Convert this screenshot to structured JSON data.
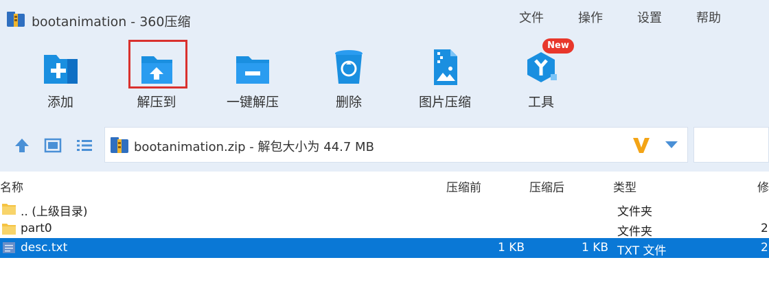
{
  "window": {
    "title": "bootanimation - 360压缩",
    "menu": [
      "文件",
      "操作",
      "设置",
      "帮助"
    ]
  },
  "toolbar": {
    "items": [
      {
        "label": "添加",
        "icon": "add-folder-icon"
      },
      {
        "label": "解压到",
        "icon": "extract-to-folder-icon"
      },
      {
        "label": "一键解压",
        "icon": "one-click-extract-icon"
      },
      {
        "label": "删除",
        "icon": "trash-icon"
      },
      {
        "label": "图片压缩",
        "icon": "image-compress-icon"
      },
      {
        "label": "工具",
        "icon": "tools-icon",
        "badge": "New"
      }
    ]
  },
  "address": {
    "text": "bootanimation.zip - 解包大小为 44.7 MB"
  },
  "columns": [
    "名称",
    "压缩前",
    "压缩后",
    "类型",
    "修"
  ],
  "files": [
    {
      "name": ".. (上级目录)",
      "before": "",
      "after": "",
      "type": "文件夹",
      "modified": "",
      "icon": "folder-icon",
      "selected": false
    },
    {
      "name": "part0",
      "before": "",
      "after": "",
      "type": "文件夹",
      "modified": "2",
      "icon": "folder-icon",
      "selected": false
    },
    {
      "name": "desc.txt",
      "before": "1 KB",
      "after": "1 KB",
      "type": "TXT 文件",
      "modified": "2",
      "icon": "text-file-icon",
      "selected": true
    }
  ],
  "colors": {
    "accent": "#0a78d6",
    "toolbar_bg": "#e6eef8",
    "icon_blue": "#1a8fe0",
    "highlight": "#d9312e",
    "badge": "#e8372b"
  }
}
